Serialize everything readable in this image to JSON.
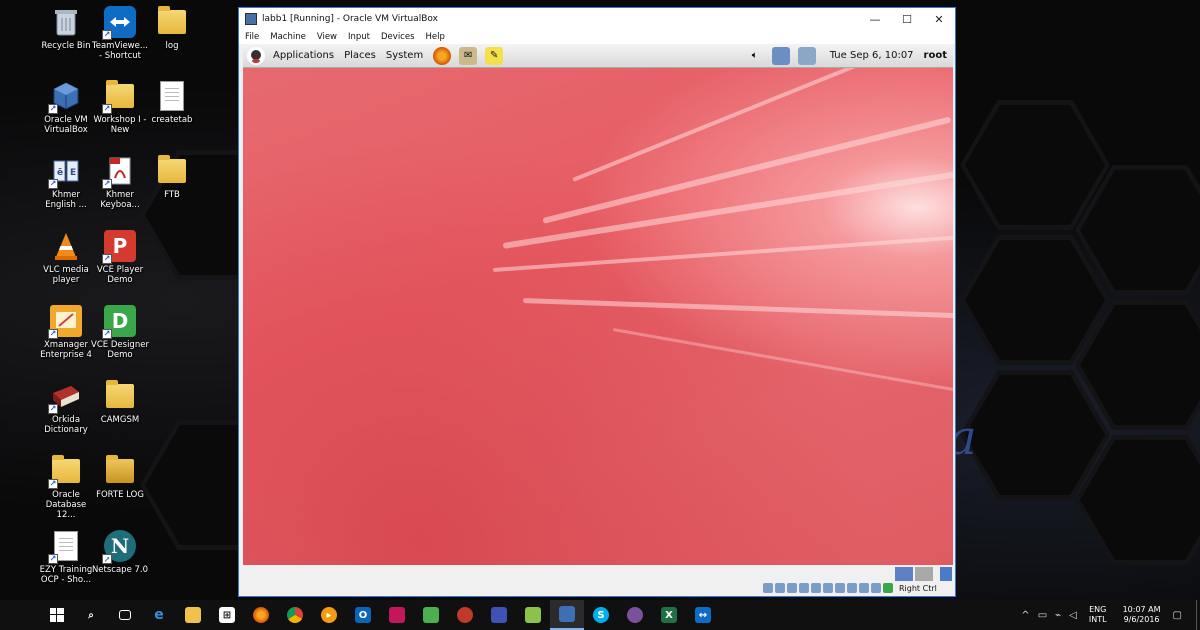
{
  "desktop": {
    "icons": [
      {
        "label": "Recycle Bin",
        "icon": "recycle-bin-icon"
      },
      {
        "label": "TeamViewe... - Shortcut",
        "icon": "teamviewer-icon"
      },
      {
        "label": "log",
        "icon": "folder-icon"
      },
      {
        "label": "Oracle VM VirtualBox",
        "icon": "virtualbox-icon"
      },
      {
        "label": "Workshop I - New",
        "icon": "folder-icon"
      },
      {
        "label": "createtab",
        "icon": "document-icon"
      },
      {
        "label": "Khmer English ...",
        "icon": "dictionary-icon"
      },
      {
        "label": "Khmer Keyboa...",
        "icon": "pdf-icon"
      },
      {
        "label": "FTB",
        "icon": "folder-icon"
      },
      {
        "label": "VLC media player",
        "icon": "vlc-icon"
      },
      {
        "label": "VCE Player Demo",
        "icon": "vce-player-icon"
      },
      {
        "label": "Xmanager Enterprise 4",
        "icon": "xmanager-icon"
      },
      {
        "label": "VCE Designer Demo",
        "icon": "vce-designer-icon"
      },
      {
        "label": "Orkida Dictionary",
        "icon": "book-icon"
      },
      {
        "label": "CAMGSM",
        "icon": "folder-icon"
      },
      {
        "label": "Oracle Database 12...",
        "icon": "folder-icon"
      },
      {
        "label": "FORTE LOG",
        "icon": "folder-icon"
      },
      {
        "label": "EZY Training OCP - Sho...",
        "icon": "document-icon"
      },
      {
        "label": "Netscape 7.0",
        "icon": "netscape-icon"
      }
    ]
  },
  "vbox": {
    "title": "labb1 [Running] - Oracle VM VirtualBox",
    "menu": [
      "File",
      "Machine",
      "View",
      "Input",
      "Devices",
      "Help"
    ],
    "host_key": "Right Ctrl"
  },
  "guest": {
    "panel_menus": [
      "Applications",
      "Places",
      "System"
    ],
    "datetime": "Tue Sep  6, 10:07",
    "user": "root"
  },
  "taskbar": {
    "lang_top": "ENG",
    "lang_bottom": "INTL",
    "time": "10:07 AM",
    "date": "9/6/2016"
  },
  "colors": {
    "guest_wallpaper": "#e56a70",
    "window_border": "#3b78d8",
    "taskbar": "#101010"
  }
}
